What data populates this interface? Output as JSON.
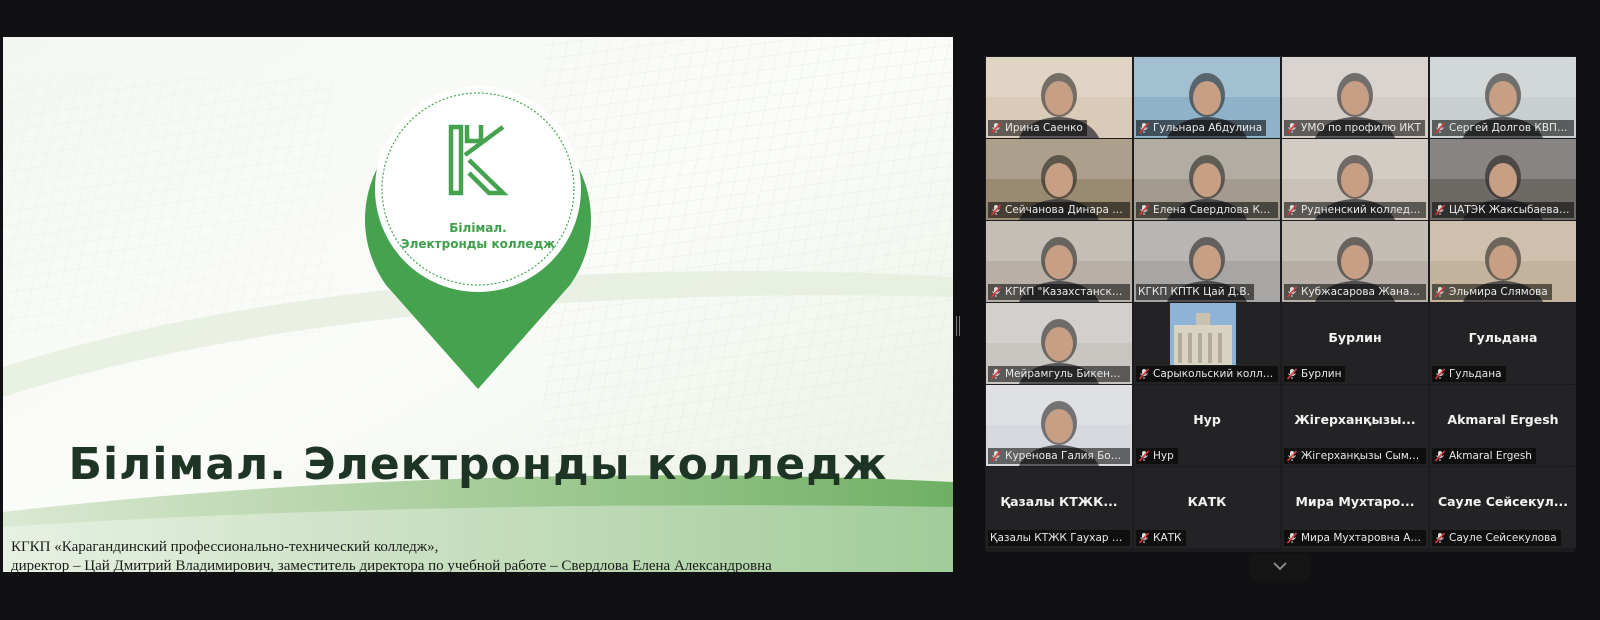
{
  "slide": {
    "logo_letter": "K",
    "logo_line1": "Білімал.",
    "logo_line2": "Электронды колледж",
    "title": "Білімал. Электронды колледж",
    "caption_line1": "КГКП «Карагандинский профессионально-технический колледж»,",
    "caption_line2": "директор – Цай Дмитрий Владимирович, заместитель директора по учебной работе – Свердлова Елена Александровна",
    "brand_color": "#3fa04b"
  },
  "gallery": {
    "tiles": [
      {
        "name": "Ирина Саенко",
        "muted": true,
        "video": "#d9cbb8"
      },
      {
        "name": "Гульнара Абдулина",
        "muted": true,
        "video": "#8fb2c9"
      },
      {
        "name": "УМО по профилю ИКТ",
        "muted": true,
        "video": "#d2cbc6"
      },
      {
        "name": "Сергей Долгов КВПТК",
        "muted": true,
        "video": "#c8cfcf"
      },
      {
        "name": "Сейчанова Динара Габ...",
        "muted": true,
        "video": "#9a8a72"
      },
      {
        "name": "Елена Свердлова КПТК",
        "muted": true,
        "video": "#a29b8e"
      },
      {
        "name": "Рудненский колледж ст...",
        "muted": true,
        "video": "#c9c1b8"
      },
      {
        "name": "ЦАТЭК Жаксыбаева На...",
        "muted": true,
        "video": "#6d6a66"
      },
      {
        "name": "КГКП \"Казахстанский аг...",
        "muted": true,
        "video": "#b8b0a6"
      },
      {
        "name": "КГКП КПТК Цай Д.В.",
        "muted": false,
        "video": "#a8a6a4",
        "active": true
      },
      {
        "name": "Кубжасарова Жанар И...",
        "muted": true,
        "video": "#b7afa7"
      },
      {
        "name": "Эльмира Слямова",
        "muted": true,
        "video": "#c4b39c"
      },
      {
        "name": "Мейрамгуль Бикенова",
        "muted": true,
        "video": "#c9c5c1"
      },
      {
        "name": "Сарыкольский колледж...",
        "muted": true,
        "video": "building"
      },
      {
        "name": "Бурлин",
        "muted": true,
        "big": "Бурлин"
      },
      {
        "name": "Гульдана",
        "muted": true,
        "big": "Гульдана"
      },
      {
        "name": "Куренова Галия Болатк...",
        "muted": true,
        "video": "#d7d9de"
      },
      {
        "name": "Нур",
        "muted": true,
        "big": "Нур"
      },
      {
        "name": "Жігерханқызы Сымбат",
        "muted": true,
        "big": "Жігерханқызы..."
      },
      {
        "name": "Akmaral Ergesh",
        "muted": true,
        "big": "Akmaral Ergesh"
      },
      {
        "name": "Қазалы КТЖК  Гаухар Сар...",
        "muted": false,
        "big": "Қазалы  КТЖК..."
      },
      {
        "name": "КАТК",
        "muted": true,
        "big": "КАТК"
      },
      {
        "name": "Мира Мухтаровна АПК",
        "muted": true,
        "big": "Мира  Мухтаро..."
      },
      {
        "name": "Сауле Сейсекулова",
        "muted": true,
        "big": "Сауле  Сейсекул..."
      }
    ],
    "mic_muted_color": "#e0393e"
  }
}
